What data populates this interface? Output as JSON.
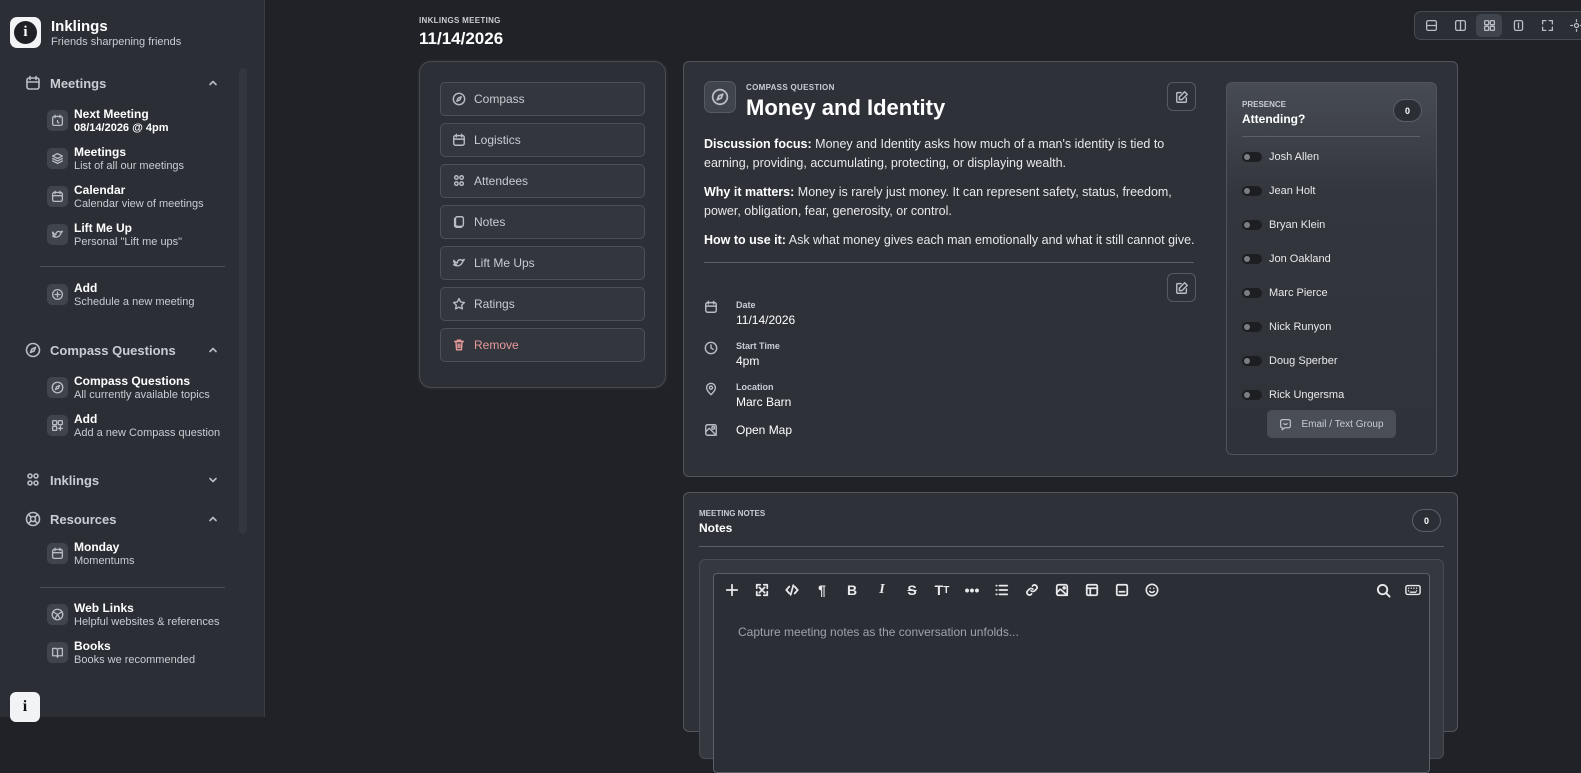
{
  "brand": {
    "title": "Inklings",
    "subtitle": "Friends sharpening friends",
    "logo_letter": "i"
  },
  "sidebar": {
    "sections": {
      "meetings": "Meetings",
      "compass": "Compass Questions",
      "inklings": "Inklings",
      "resources": "Resources"
    },
    "meetings_items": [
      {
        "title": "Next Meeting",
        "subtitle": "08/14/2026 @ 4pm"
      },
      {
        "title": "Meetings",
        "subtitle": "List of all our meetings"
      },
      {
        "title": "Calendar",
        "subtitle": "Calendar view of meetings"
      },
      {
        "title": "Lift Me Up",
        "subtitle": "Personal \"Lift me ups\""
      },
      {
        "title": "Add",
        "subtitle": "Schedule a new meeting"
      }
    ],
    "compass_items": [
      {
        "title": "Compass Questions",
        "subtitle": "All currently available topics"
      },
      {
        "title": "Add",
        "subtitle": "Add a new Compass question"
      }
    ],
    "resources_items": [
      {
        "title": "Monday",
        "subtitle": "Momentums"
      },
      {
        "title": "Web Links",
        "subtitle": "Helpful websites & references"
      },
      {
        "title": "Books",
        "subtitle": "Books we recommended"
      }
    ],
    "footer_letter": "i"
  },
  "header": {
    "label": "INKLINGS MEETING",
    "date": "11/14/2026"
  },
  "nav": [
    "Compass",
    "Logistics",
    "Attendees",
    "Notes",
    "Lift Me Ups",
    "Ratings",
    "Remove"
  ],
  "compass": {
    "label": "COMPASS QUESTION",
    "title": "Money and Identity",
    "focus_label": "Discussion focus:",
    "focus_text": "Money and Identity asks how much of a man's identity is tied to earning, providing, accumulating, protecting, or displaying wealth.",
    "matters_label": "Why it matters:",
    "matters_text": "Money is rarely just money. It can represent safety, status, freedom, power, obligation, fear, generosity, or control.",
    "use_label": "How to use it:",
    "use_text": "Ask what money gives each man emotionally and what it still cannot give."
  },
  "details": {
    "date_label": "Date",
    "date": "11/14/2026",
    "time_label": "Start Time",
    "time": "4pm",
    "location_label": "Location",
    "location": "Marc Barn",
    "map": "Open Map"
  },
  "presence": {
    "label": "PRESENCE",
    "title": "Attending?",
    "count": "0",
    "people": [
      "Josh Allen",
      "Jean Holt",
      "Bryan Klein",
      "Jon Oakland",
      "Marc Pierce",
      "Nick Runyon",
      "Doug Sperber",
      "Rick Ungersma"
    ],
    "email_button": "Email / Text Group"
  },
  "notes": {
    "label": "MEETING NOTES",
    "title": "Notes",
    "count": "0",
    "placeholder": "Capture meeting notes as the conversation unfolds..."
  }
}
